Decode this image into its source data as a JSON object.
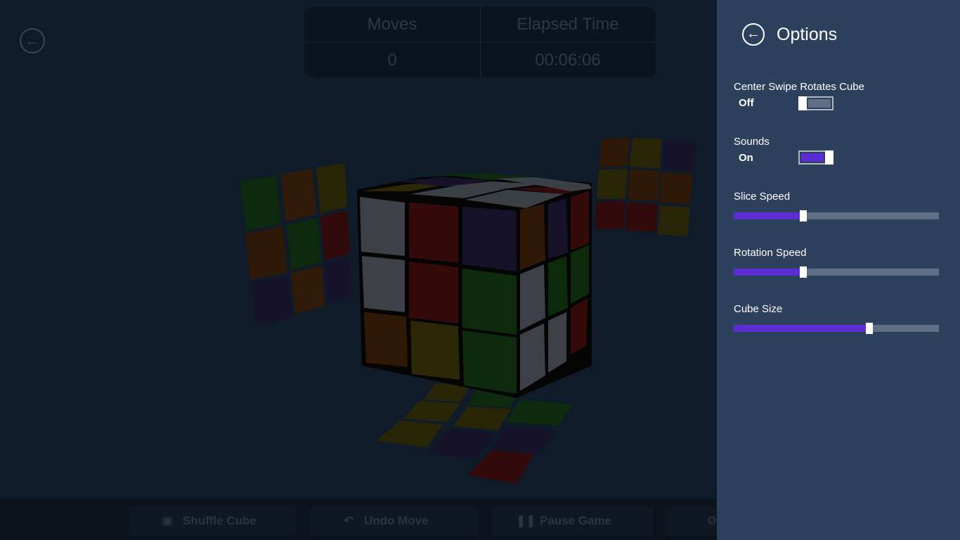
{
  "game": {
    "back_icon": "arrow-left-icon",
    "stats": {
      "moves_label": "Moves",
      "moves_value": "0",
      "time_label": "Elapsed Time",
      "time_value": "00:06:06"
    },
    "appbar": {
      "shuffle_label": "Shuffle Cube",
      "undo_label": "Undo Move",
      "pause_label": "Pause Game",
      "shuffle_icon": "rubiks-cube-icon",
      "undo_icon": "undo-icon",
      "pause_icon": "pause-icon",
      "more_icon": "gear-icon"
    }
  },
  "options": {
    "title": "Options",
    "back_icon": "arrow-left-icon",
    "center_swipe": {
      "label": "Center Swipe Rotates Cube",
      "state": "Off",
      "on": false
    },
    "sounds": {
      "label": "Sounds",
      "state": "On",
      "on": true
    },
    "slice_speed": {
      "label": "Slice Speed",
      "value": 0.34
    },
    "rotation_speed": {
      "label": "Rotation Speed",
      "value": 0.34
    },
    "cube_size": {
      "label": "Cube Size",
      "value": 0.66
    }
  },
  "colors": {
    "accent": "#5b2dd1",
    "panel": "#2d405c",
    "toggle_off": "#5f6f86"
  }
}
